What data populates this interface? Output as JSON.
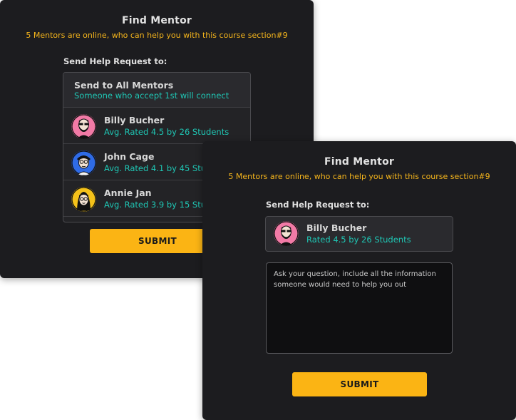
{
  "panel_a": {
    "title": "Find Mentor",
    "subtitle": "5 Mentors are online, who can help you with this course section#9",
    "section_label": "Send Help Request to:",
    "send_all": {
      "name": "Send to All Mentors",
      "sub": "Someone who accept 1st will connect"
    },
    "mentors": [
      {
        "name": "Billy Bucher",
        "rating": "Avg. Rated 4.5 by 26 Students",
        "avatar_color": "#f27aa6"
      },
      {
        "name": "John Cage",
        "rating": "Avg. Rated 4.1 by 45 Students",
        "avatar_color": "#2f6be6"
      },
      {
        "name": "Annie Jan",
        "rating": "Avg. Rated 3.9 by 15 Students",
        "avatar_color": "#f5c21a"
      }
    ],
    "submit_label": "SUBMIT"
  },
  "panel_b": {
    "title": "Find Mentor",
    "subtitle": "5 Mentors are online, who can help you with this course section#9",
    "section_label": "Send Help Request to:",
    "selected": {
      "name": "Billy Bucher",
      "rating": "Rated 4.5 by 26 Students",
      "avatar_color": "#f27aa6"
    },
    "question_placeholder": "Ask your question, include all the information someone would need to help you out",
    "submit_label": "SUBMIT"
  },
  "colors": {
    "accent": "#fbb414",
    "teal": "#1fc7b5",
    "panel": "#1c1c1f"
  }
}
